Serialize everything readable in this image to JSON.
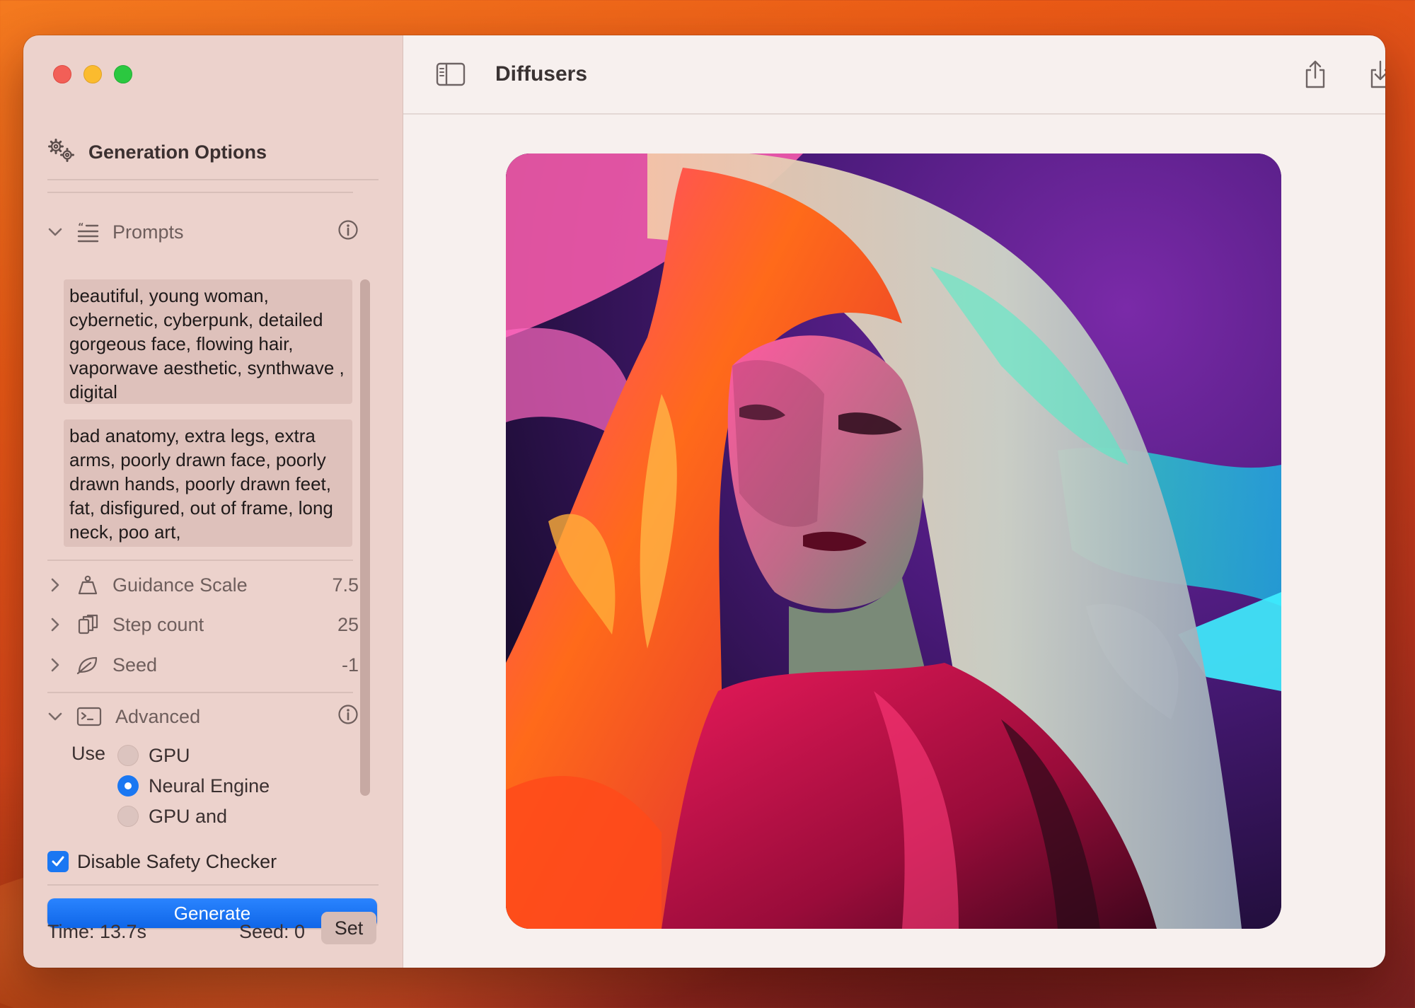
{
  "window": {
    "title": "Diffusers"
  },
  "sidebar": {
    "header": {
      "title": "Generation Options",
      "icon": "gears-icon"
    },
    "prompts": {
      "label": "Prompts",
      "positive": "beautiful, young woman, cybernetic, cyberpunk, detailed gorgeous face, flowing hair, vaporwave aesthetic, synthwave , digital",
      "negative": "bad anatomy, extra legs, extra arms, poorly drawn face, poorly drawn hands, poorly drawn feet, fat, disfigured, out of frame, long neck, poo art,"
    },
    "guidance": {
      "label": "Guidance Scale",
      "value": "7.5"
    },
    "steps": {
      "label": "Step count",
      "value": "25"
    },
    "seed": {
      "label": "Seed",
      "value": "-1"
    },
    "advanced": {
      "label": "Advanced",
      "use_label": "Use",
      "options": [
        "GPU",
        "Neural Engine",
        "GPU and"
      ],
      "selected": "Neural Engine"
    },
    "safety": {
      "label": "Disable Safety Checker",
      "checked": true
    },
    "generate_label": "Generate",
    "footer": {
      "time": "Time: 13.7s",
      "seed": "Seed: 0",
      "set_label": "Set"
    }
  },
  "colors": {
    "accent": "#1a77f2",
    "sidebar_bg": "#ecd2cc",
    "main_bg": "#f7f0ee"
  }
}
